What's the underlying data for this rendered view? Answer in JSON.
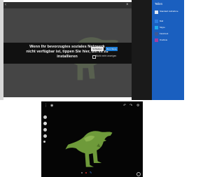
{
  "dialog": {
    "message": "Wenn Ihr bevorzugtes soziales Netzwerk nicht verfügbar ist, tippen Sie hier, um es zu installieren",
    "buttons": [
      "Schließen",
      "Zum Store"
    ],
    "checkbox_label": "Nicht mehr anzeigen"
  },
  "share_charm": {
    "title": "Teilen",
    "header": "Standard Aufnahme",
    "items": [
      {
        "label": "Mail",
        "icon": "mail-icon",
        "color": "#2b7de0"
      },
      {
        "label": "Skype",
        "icon": "skype-icon",
        "color": "#20a8e8"
      },
      {
        "label": "Facebook",
        "icon": "facebook-icon",
        "color": "#3b5998"
      },
      {
        "label": "OneNote",
        "icon": "onenote-icon",
        "color": "#a23fa0"
      }
    ]
  },
  "colors": {
    "share_pane": "#1a5fbf",
    "dialog_bg": "#111111",
    "store_button": "#1e7fd8",
    "app_background": "#050505",
    "dino_green": "#6e9a3a"
  }
}
